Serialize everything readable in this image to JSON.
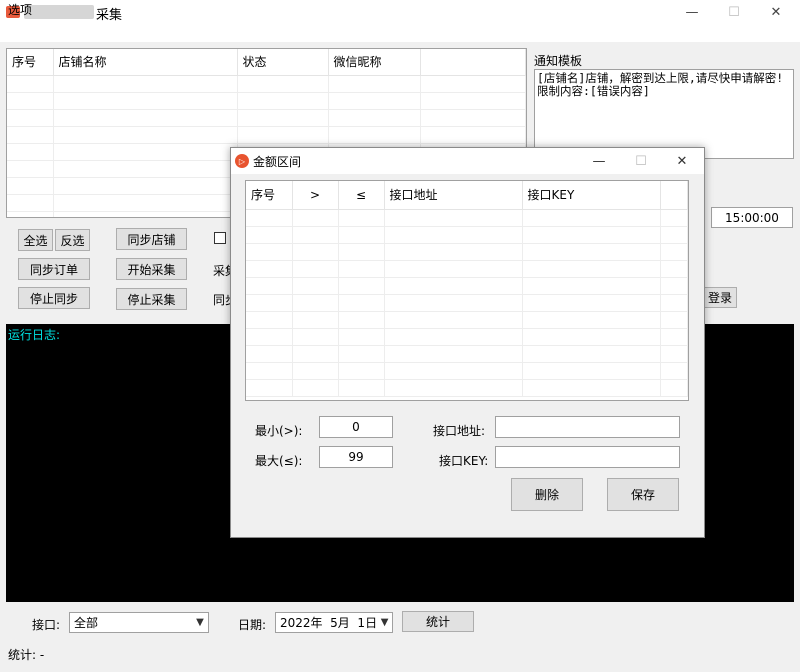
{
  "window": {
    "title": "采集",
    "min_glyph": "—",
    "max_glyph": "☐",
    "close_glyph": "✕"
  },
  "menu": {
    "options": "选项"
  },
  "store_table": {
    "columns": [
      "序号",
      "店铺名称",
      "状态",
      "微信昵称",
      ""
    ]
  },
  "notify": {
    "label": "通知模板",
    "text": "[店铺名]店铺，解密到达上限,请尽快申请解密!\n限制内容:[错误内容]"
  },
  "buttons": {
    "select_all": "全选",
    "invert": "反选",
    "sync_store": "同步店铺",
    "sync_order": "同步订单",
    "start_collect": "开始采集",
    "stop_sync": "停止同步",
    "stop_collect": "停止采集",
    "login": "登录",
    "stats": "统计"
  },
  "labels": {
    "collect": "采集",
    "sync": "同步",
    "run_log": "运行日志:",
    "port": "接口:",
    "date": "日期:",
    "status": "统计: -"
  },
  "time_value": "15:00:00",
  "port_select": {
    "value": "全部"
  },
  "date_select": {
    "value": "2022年  5月  1日"
  },
  "dialog": {
    "title": "金额区间",
    "icon_glyph": "▷",
    "columns": [
      "序号",
      ">",
      "≤",
      "接口地址",
      "接口KEY",
      ""
    ],
    "min_label": "最小(>):",
    "min_value": "0",
    "max_label": "最大(≤):",
    "max_value": "99",
    "url_label": "接口地址:",
    "key_label": "接口KEY:",
    "delete": "删除",
    "save": "保存"
  },
  "colors": {
    "log_text": "#00e0e0",
    "logo": "#e85a3c",
    "dialog_icon": "#e8542f"
  }
}
